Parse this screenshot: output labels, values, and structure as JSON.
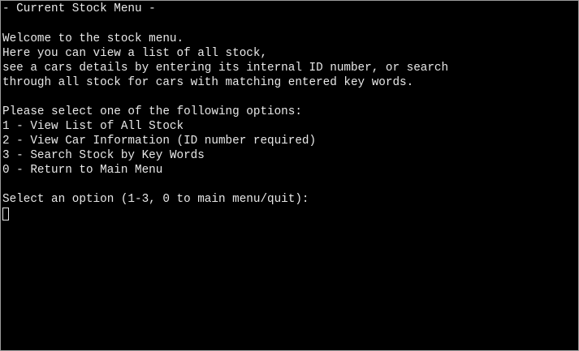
{
  "window": {
    "title": "- Current Stock Menu -"
  },
  "intro": {
    "line1": "Welcome to the stock menu.",
    "line2": "Here you can view a list of all stock,",
    "line3": "see a cars details by entering its internal ID number, or search",
    "line4": "through all stock for cars with matching entered key words."
  },
  "menu": {
    "heading": "Please select one of the following options:",
    "options": [
      {
        "label": "1 - View List of All Stock"
      },
      {
        "label": "2 - View Car Information (ID number required)"
      },
      {
        "label": "3 - Search Stock by Key Words"
      },
      {
        "label": "0 - Return to Main Menu"
      }
    ]
  },
  "prompt": {
    "text": "Select an option (1-3, 0 to main menu/quit):"
  },
  "colors": {
    "background": "#000000",
    "text": "#e8e8e8"
  }
}
